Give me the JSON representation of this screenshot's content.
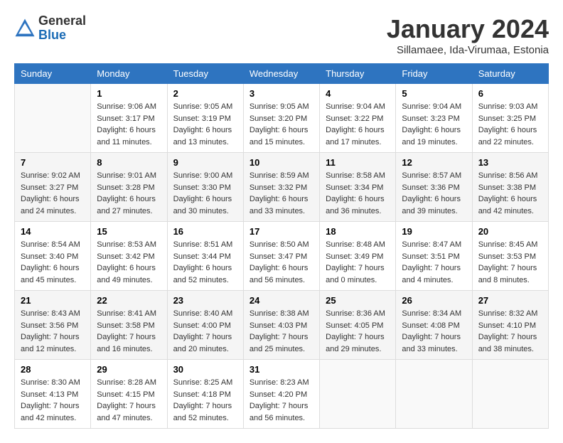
{
  "header": {
    "logo_general": "General",
    "logo_blue": "Blue",
    "month_title": "January 2024",
    "location": "Sillamaee, Ida-Virumaa, Estonia"
  },
  "weekdays": [
    "Sunday",
    "Monday",
    "Tuesday",
    "Wednesday",
    "Thursday",
    "Friday",
    "Saturday"
  ],
  "weeks": [
    [
      {
        "day": "",
        "info": ""
      },
      {
        "day": "1",
        "info": "Sunrise: 9:06 AM\nSunset: 3:17 PM\nDaylight: 6 hours\nand 11 minutes."
      },
      {
        "day": "2",
        "info": "Sunrise: 9:05 AM\nSunset: 3:19 PM\nDaylight: 6 hours\nand 13 minutes."
      },
      {
        "day": "3",
        "info": "Sunrise: 9:05 AM\nSunset: 3:20 PM\nDaylight: 6 hours\nand 15 minutes."
      },
      {
        "day": "4",
        "info": "Sunrise: 9:04 AM\nSunset: 3:22 PM\nDaylight: 6 hours\nand 17 minutes."
      },
      {
        "day": "5",
        "info": "Sunrise: 9:04 AM\nSunset: 3:23 PM\nDaylight: 6 hours\nand 19 minutes."
      },
      {
        "day": "6",
        "info": "Sunrise: 9:03 AM\nSunset: 3:25 PM\nDaylight: 6 hours\nand 22 minutes."
      }
    ],
    [
      {
        "day": "7",
        "info": "Sunrise: 9:02 AM\nSunset: 3:27 PM\nDaylight: 6 hours\nand 24 minutes."
      },
      {
        "day": "8",
        "info": "Sunrise: 9:01 AM\nSunset: 3:28 PM\nDaylight: 6 hours\nand 27 minutes."
      },
      {
        "day": "9",
        "info": "Sunrise: 9:00 AM\nSunset: 3:30 PM\nDaylight: 6 hours\nand 30 minutes."
      },
      {
        "day": "10",
        "info": "Sunrise: 8:59 AM\nSunset: 3:32 PM\nDaylight: 6 hours\nand 33 minutes."
      },
      {
        "day": "11",
        "info": "Sunrise: 8:58 AM\nSunset: 3:34 PM\nDaylight: 6 hours\nand 36 minutes."
      },
      {
        "day": "12",
        "info": "Sunrise: 8:57 AM\nSunset: 3:36 PM\nDaylight: 6 hours\nand 39 minutes."
      },
      {
        "day": "13",
        "info": "Sunrise: 8:56 AM\nSunset: 3:38 PM\nDaylight: 6 hours\nand 42 minutes."
      }
    ],
    [
      {
        "day": "14",
        "info": "Sunrise: 8:54 AM\nSunset: 3:40 PM\nDaylight: 6 hours\nand 45 minutes."
      },
      {
        "day": "15",
        "info": "Sunrise: 8:53 AM\nSunset: 3:42 PM\nDaylight: 6 hours\nand 49 minutes."
      },
      {
        "day": "16",
        "info": "Sunrise: 8:51 AM\nSunset: 3:44 PM\nDaylight: 6 hours\nand 52 minutes."
      },
      {
        "day": "17",
        "info": "Sunrise: 8:50 AM\nSunset: 3:47 PM\nDaylight: 6 hours\nand 56 minutes."
      },
      {
        "day": "18",
        "info": "Sunrise: 8:48 AM\nSunset: 3:49 PM\nDaylight: 7 hours\nand 0 minutes."
      },
      {
        "day": "19",
        "info": "Sunrise: 8:47 AM\nSunset: 3:51 PM\nDaylight: 7 hours\nand 4 minutes."
      },
      {
        "day": "20",
        "info": "Sunrise: 8:45 AM\nSunset: 3:53 PM\nDaylight: 7 hours\nand 8 minutes."
      }
    ],
    [
      {
        "day": "21",
        "info": "Sunrise: 8:43 AM\nSunset: 3:56 PM\nDaylight: 7 hours\nand 12 minutes."
      },
      {
        "day": "22",
        "info": "Sunrise: 8:41 AM\nSunset: 3:58 PM\nDaylight: 7 hours\nand 16 minutes."
      },
      {
        "day": "23",
        "info": "Sunrise: 8:40 AM\nSunset: 4:00 PM\nDaylight: 7 hours\nand 20 minutes."
      },
      {
        "day": "24",
        "info": "Sunrise: 8:38 AM\nSunset: 4:03 PM\nDaylight: 7 hours\nand 25 minutes."
      },
      {
        "day": "25",
        "info": "Sunrise: 8:36 AM\nSunset: 4:05 PM\nDaylight: 7 hours\nand 29 minutes."
      },
      {
        "day": "26",
        "info": "Sunrise: 8:34 AM\nSunset: 4:08 PM\nDaylight: 7 hours\nand 33 minutes."
      },
      {
        "day": "27",
        "info": "Sunrise: 8:32 AM\nSunset: 4:10 PM\nDaylight: 7 hours\nand 38 minutes."
      }
    ],
    [
      {
        "day": "28",
        "info": "Sunrise: 8:30 AM\nSunset: 4:13 PM\nDaylight: 7 hours\nand 42 minutes."
      },
      {
        "day": "29",
        "info": "Sunrise: 8:28 AM\nSunset: 4:15 PM\nDaylight: 7 hours\nand 47 minutes."
      },
      {
        "day": "30",
        "info": "Sunrise: 8:25 AM\nSunset: 4:18 PM\nDaylight: 7 hours\nand 52 minutes."
      },
      {
        "day": "31",
        "info": "Sunrise: 8:23 AM\nSunset: 4:20 PM\nDaylight: 7 hours\nand 56 minutes."
      },
      {
        "day": "",
        "info": ""
      },
      {
        "day": "",
        "info": ""
      },
      {
        "day": "",
        "info": ""
      }
    ]
  ]
}
